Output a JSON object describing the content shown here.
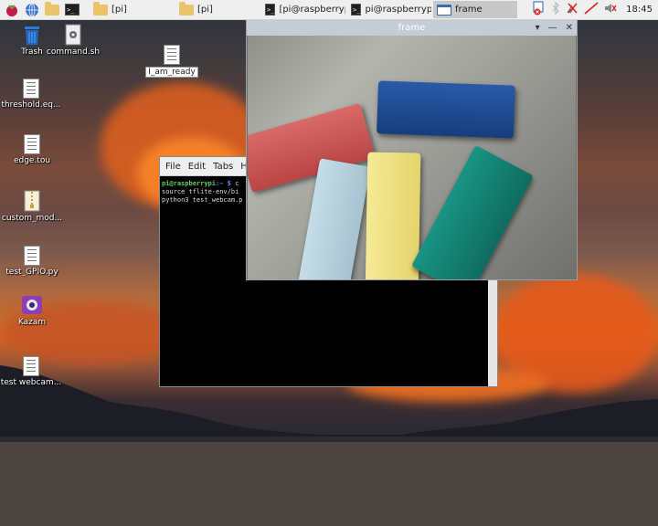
{
  "taskbar": {
    "launchers": [
      "raspberry-menu-icon",
      "web-browser-icon",
      "file-manager-icon",
      "terminal-icon"
    ],
    "windows": [
      {
        "label": "[pi]",
        "icon": "folder-icon"
      },
      {
        "label": "[pi]",
        "icon": "folder-icon"
      },
      {
        "label": "[pi@raspberrypi: ...",
        "icon": "terminal-icon"
      },
      {
        "label": "pi@raspberrypi: ~",
        "icon": "terminal-icon"
      },
      {
        "label": "frame",
        "icon": "window-icon",
        "active": true
      }
    ],
    "tray_icons": [
      "vnc-icon",
      "bluetooth-icon",
      "network-disconnected-icon",
      "cpu-monitor-icon",
      "volume-muted-icon"
    ],
    "clock": "18:45"
  },
  "desktop_icons": [
    {
      "label": "Trash",
      "icon": "trash-icon"
    },
    {
      "label": "command.sh",
      "icon": "script-icon"
    },
    {
      "label": "I_am_ready",
      "icon": "document-icon",
      "selected": true
    },
    {
      "label": "threshold.eq...",
      "icon": "document-icon"
    },
    {
      "label": "edge.tou",
      "icon": "document-icon"
    },
    {
      "label": "custom_mod...",
      "icon": "archive-icon"
    },
    {
      "label": "test_GPIO.py",
      "icon": "document-icon"
    },
    {
      "label": "Kazam",
      "icon": "kazam-icon"
    },
    {
      "label": "test webcam...",
      "icon": "document-icon"
    }
  ],
  "terminal": {
    "menu": [
      "File",
      "Edit",
      "Tabs",
      "Hel"
    ],
    "prompt_user": "pi@raspberrypi",
    "prompt_path": ":~ $",
    "command_1": " c",
    "line_2": "source tflite-env/bi",
    "line_3": "python3 test_webcam.p"
  },
  "frame_window": {
    "title": "frame",
    "controls": [
      "▾",
      "—",
      "✕"
    ]
  },
  "colors": {
    "taskbar_bg": "#efefef",
    "frame_title_bg": "#c4ccd6",
    "block_red": "#c8504f",
    "block_blue": "#1f4a8f",
    "block_lightblue": "#b3cfdc",
    "block_yellow": "#f0e486",
    "block_green": "#137f6f"
  }
}
